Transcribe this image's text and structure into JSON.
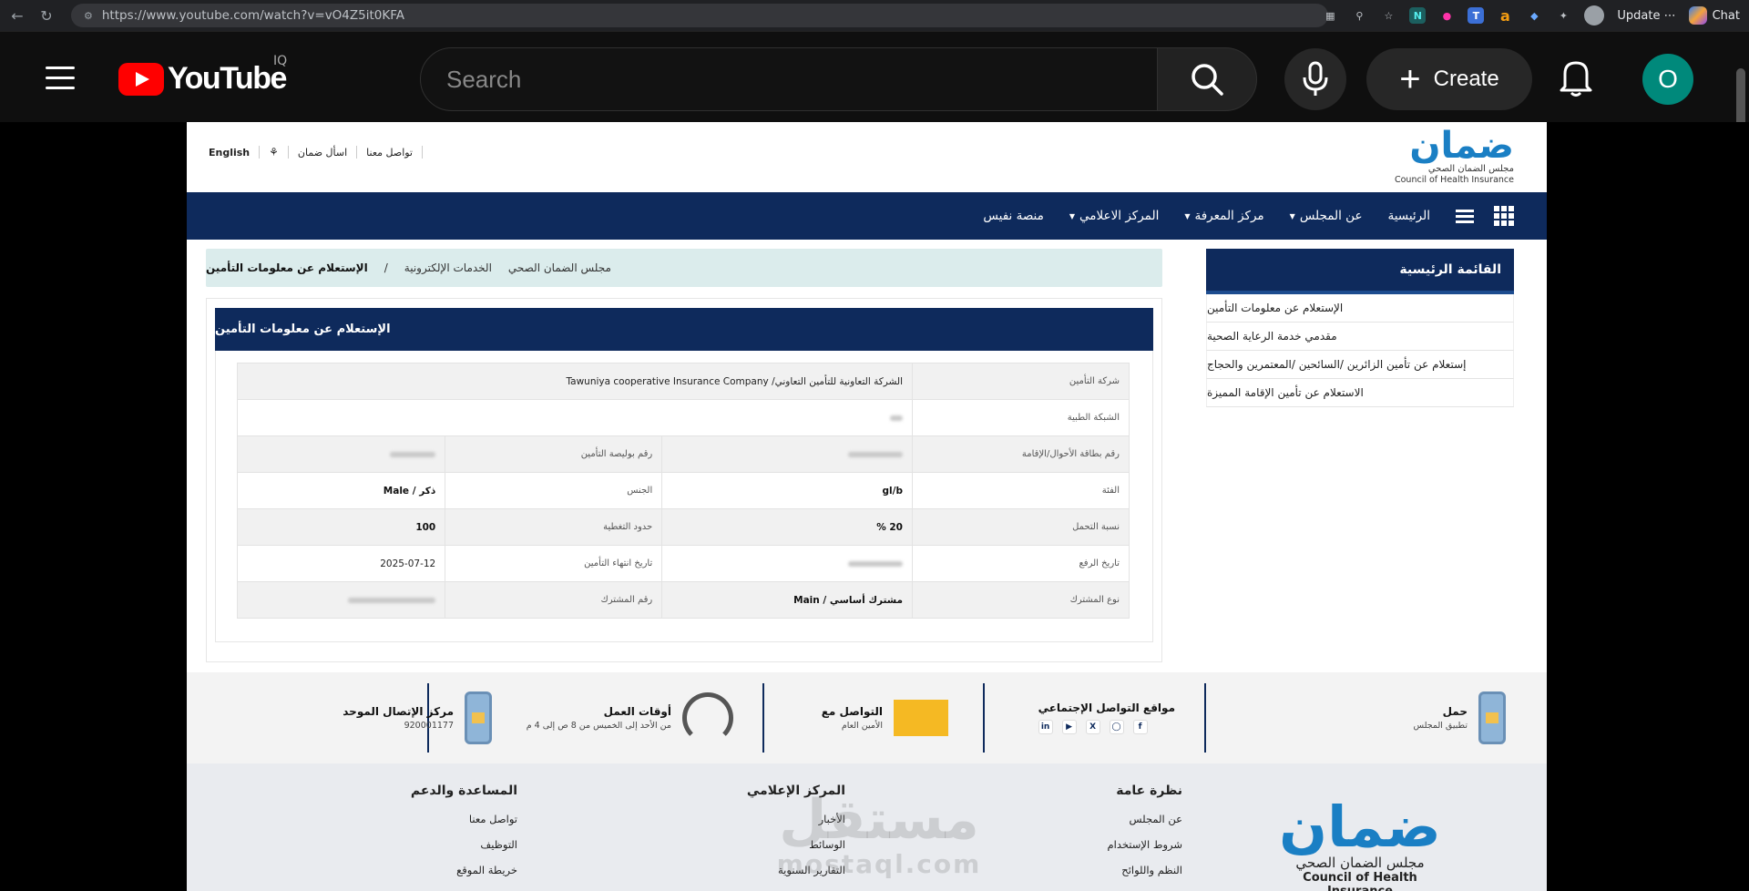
{
  "browser": {
    "url": "https://www.youtube.com/watch?v=vO4Z5it0KFA",
    "update_label": "Update",
    "chat_label": "Chat"
  },
  "youtube": {
    "logo_text": "YouTube",
    "country": "IQ",
    "search_placeholder": "Search",
    "create_label": "Create",
    "avatar_letter": "O"
  },
  "site": {
    "top_links": {
      "contact": "تواصل معنا",
      "ask": "اسأل ضمان",
      "english": "English"
    },
    "logo": {
      "arabic": "ضمان",
      "sub_ar": "مجلس الضمان الصحي",
      "sub_en": "Council of Health Insurance"
    },
    "nav": [
      {
        "label": "الرئيسية",
        "caret": false
      },
      {
        "label": "عن المجلس",
        "caret": true
      },
      {
        "label": "مركز المعرفة",
        "caret": true
      },
      {
        "label": "المركز الاعلامي",
        "caret": true
      },
      {
        "label": "منصة نفيس",
        "caret": false
      }
    ],
    "sidebar": {
      "title": "القائمة الرئيسية",
      "items": [
        "الإستعلام عن معلومات التأمين",
        "مقدمي خدمة الرعاية الصحية",
        "إستعلام عن تأمين الزائرين /السائحين /المعتمرين والحجاج",
        "الاستعلام عن تأمين الإقامة المميزة"
      ]
    },
    "breadcrumb": {
      "home": "مجلس الضمان الصحي",
      "section": "الخدمات الإلكترونية",
      "separator": "/",
      "current": "الإستعلام عن معلومات التأمين"
    },
    "card_title": "الإستعلام عن معلومات التأمين",
    "table": {
      "insurer_label": "شركة التأمين",
      "insurer_value": "الشركة التعاونية للتأمين التعاوني/ Tawuniya cooperative Insurance Company",
      "network_label": "الشبكة الطبية",
      "id_label": "رقم بطاقة الأحوال/الإقامة",
      "policy_label": "رقم بوليصة التأمين",
      "class_label": "الفئة",
      "class_value": "gl/b",
      "gender_label": "الجنس",
      "gender_value": "ذكر / Male",
      "copay_label": "نسبة التحمل",
      "copay_value": "20 %",
      "coverage_label": "حدود التغطية",
      "coverage_value": "100",
      "start_label": "تاريخ الرفع",
      "end_label": "تاريخ انتهاء التأمين",
      "end_value": "2025-07-12",
      "subtype_label": "نوع المشترك",
      "subtype_value": "مشترك أساسي / Main",
      "subno_label": "رقم المشترك"
    },
    "strip": {
      "app_title": "حمل",
      "app_sub": "تطبيق المجلس",
      "social_title": "مواقع التواصل الإجتماعي",
      "contact_title": "التواصل مع",
      "contact_sub": "الأمين العام",
      "hours_title": "أوقات العمل",
      "hours_sub": "من الأحد إلى الخميس من 8 ص إلى 4 م",
      "center_title": "مركز الإتصال الموحد",
      "center_phone": "920001177"
    },
    "footer": {
      "col1_title": "نظرة عامة",
      "col1_items": [
        "عن المجلس",
        "شروط الإستخدام",
        "النظم واللوائح"
      ],
      "col2_title": "المركز الإعلامي",
      "col2_items": [
        "الأخبار",
        "الوسائط",
        "التقارير السنوية"
      ],
      "col3_title": "المساعدة والدعم",
      "col3_items": [
        "تواصل معنا",
        "التوظيف",
        "خريطة الموقع"
      ],
      "watermark_ar": "مستقل",
      "watermark_en": "mostaql.com"
    }
  }
}
